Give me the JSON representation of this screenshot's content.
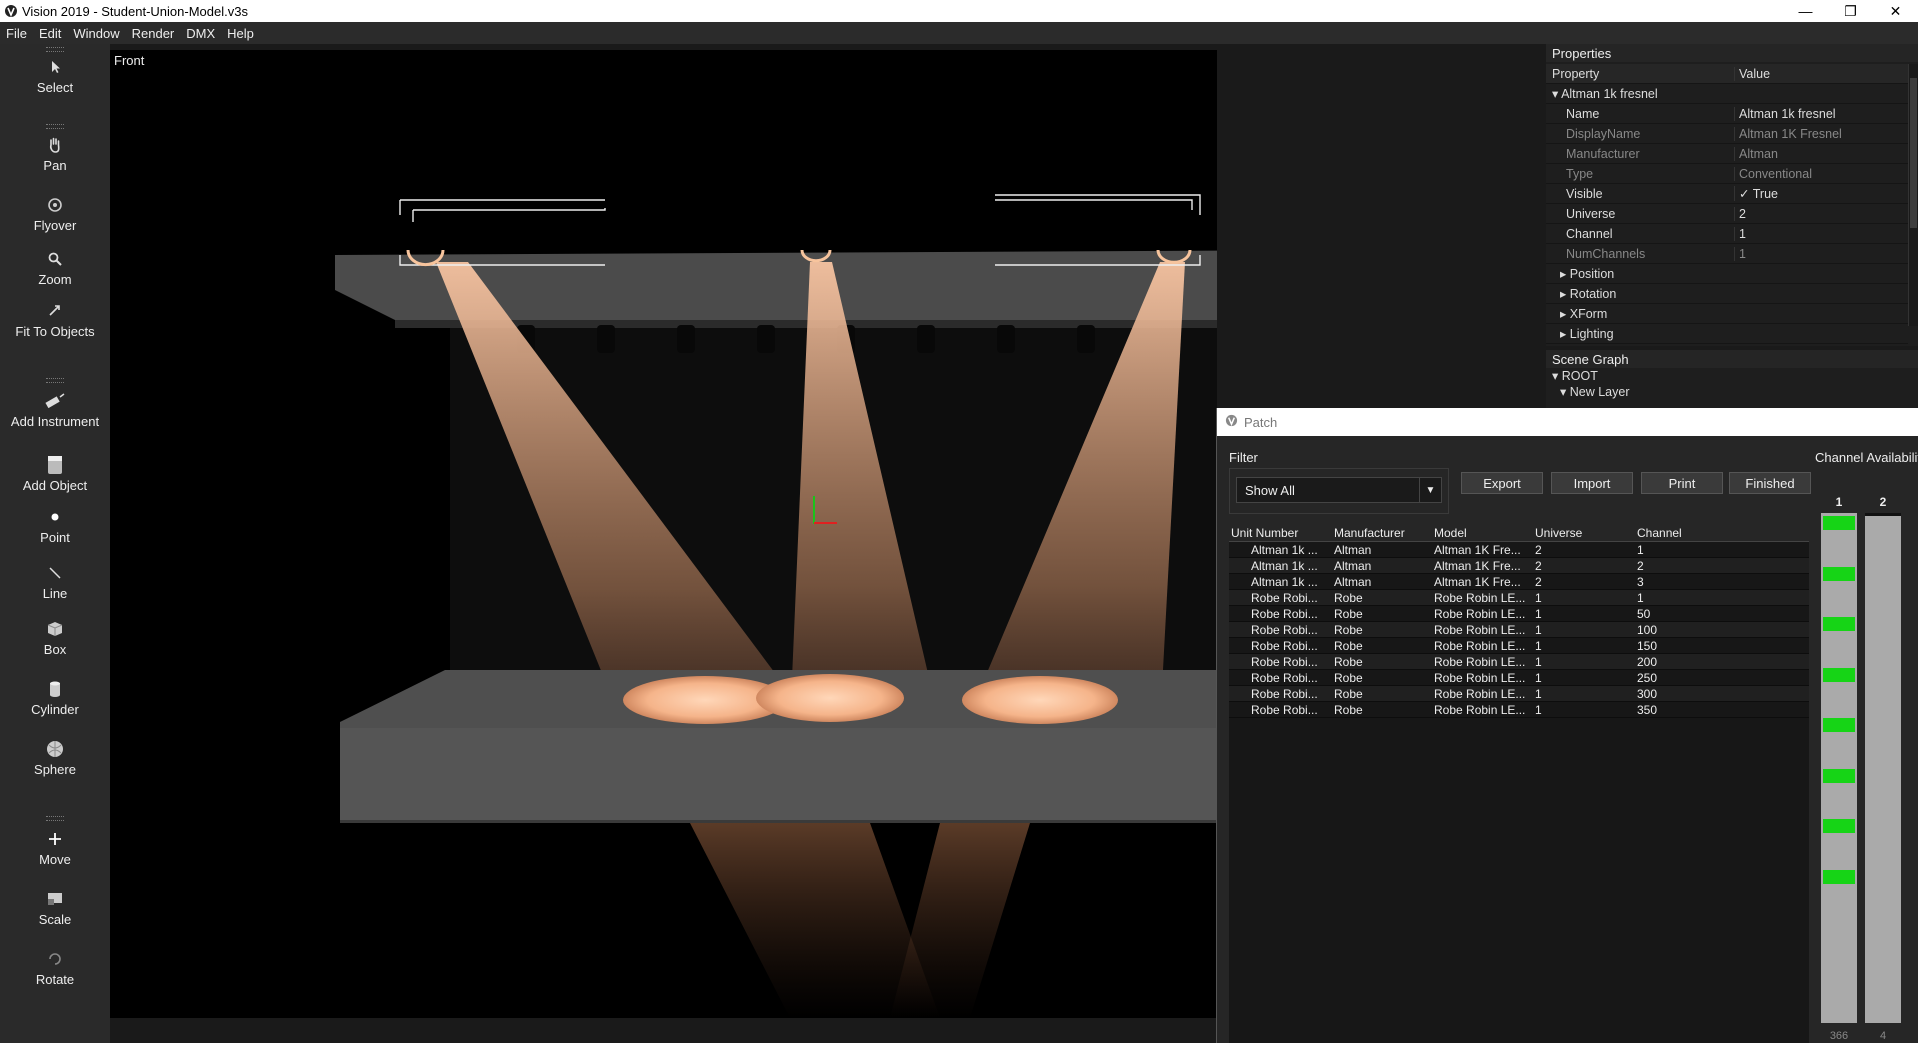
{
  "app": {
    "title": "Vision 2019 - Student-Union-Model.v3s",
    "window_controls": [
      "—",
      "❐",
      "✕"
    ]
  },
  "menu": [
    "File",
    "Edit",
    "Window",
    "Render",
    "DMX",
    "Help"
  ],
  "toolbar": {
    "tools": [
      {
        "label": "Select",
        "icon": "cursor-icon"
      },
      {
        "label": "Pan",
        "icon": "hand-icon"
      },
      {
        "label": "Flyover",
        "icon": "flyover-icon"
      },
      {
        "label": "Zoom",
        "icon": "magnifier-icon"
      },
      {
        "label": "Fit To Objects",
        "icon": "fit-icon"
      },
      {
        "label": "Add Instrument",
        "icon": "instrument-icon"
      },
      {
        "label": "Add Object",
        "icon": "object-icon"
      },
      {
        "label": "Point",
        "icon": "point-icon"
      },
      {
        "label": "Line",
        "icon": "line-icon"
      },
      {
        "label": "Box",
        "icon": "box-icon"
      },
      {
        "label": "Cylinder",
        "icon": "cylinder-icon"
      },
      {
        "label": "Sphere",
        "icon": "sphere-icon"
      },
      {
        "label": "Move",
        "icon": "move-icon"
      },
      {
        "label": "Scale",
        "icon": "scale-icon"
      },
      {
        "label": "Rotate",
        "icon": "rotate-icon"
      }
    ]
  },
  "viewport": {
    "label": "Front"
  },
  "properties": {
    "title": "Properties",
    "col_property": "Property",
    "col_value": "Value",
    "group": "Altman 1k fresnel",
    "rows": [
      {
        "k": "Name",
        "v": "Altman 1k fresnel"
      },
      {
        "k": "DisplayName",
        "v": "Altman 1K Fresnel"
      },
      {
        "k": "Manufacturer",
        "v": "Altman"
      },
      {
        "k": "Type",
        "v": "Conventional"
      },
      {
        "k": "Visible",
        "v": "True"
      },
      {
        "k": "Universe",
        "v": "2"
      },
      {
        "k": "Channel",
        "v": "1"
      },
      {
        "k": "NumChannels",
        "v": "1"
      }
    ],
    "subgroups": [
      "Position",
      "Rotation",
      "XForm",
      "Lighting"
    ]
  },
  "scene_graph": {
    "title": "Scene Graph",
    "root": "ROOT",
    "layer": "New Layer"
  },
  "patch": {
    "title": "Patch",
    "filter_label": "Filter",
    "filter_value": "Show All",
    "buttons": [
      "Export",
      "Import",
      "Print",
      "Finished"
    ],
    "columns": [
      "Unit Number",
      "Manufacturer",
      "Model",
      "Universe",
      "Channel"
    ],
    "rows": [
      [
        "Altman 1k ...",
        "Altman",
        "Altman 1K Fre...",
        "2",
        "1"
      ],
      [
        "Altman 1k ...",
        "Altman",
        "Altman 1K Fre...",
        "2",
        "2"
      ],
      [
        "Altman 1k ...",
        "Altman",
        "Altman 1K Fre...",
        "2",
        "3"
      ],
      [
        "Robe Robi...",
        "Robe",
        "Robe Robin LE...",
        "1",
        "1"
      ],
      [
        "Robe Robi...",
        "Robe",
        "Robe Robin LE...",
        "1",
        "50"
      ],
      [
        "Robe Robi...",
        "Robe",
        "Robe Robin LE...",
        "1",
        "100"
      ],
      [
        "Robe Robi...",
        "Robe",
        "Robe Robin LE...",
        "1",
        "150"
      ],
      [
        "Robe Robi...",
        "Robe",
        "Robe Robin LE...",
        "1",
        "200"
      ],
      [
        "Robe Robi...",
        "Robe",
        "Robe Robin LE...",
        "1",
        "250"
      ],
      [
        "Robe Robi...",
        "Robe",
        "Robe Robin LE...",
        "1",
        "300"
      ],
      [
        "Robe Robi...",
        "Robe",
        "Robe Robin LE...",
        "1",
        "350"
      ]
    ],
    "channel_availability": {
      "label": "Channel Availability",
      "universes": [
        {
          "name": "1",
          "free": "366",
          "used_segments": 8
        },
        {
          "name": "2",
          "free": "4",
          "used_segments": 0
        }
      ]
    }
  },
  "colors": {
    "accent_green": "#16d416",
    "beam": "#f4b48c"
  }
}
